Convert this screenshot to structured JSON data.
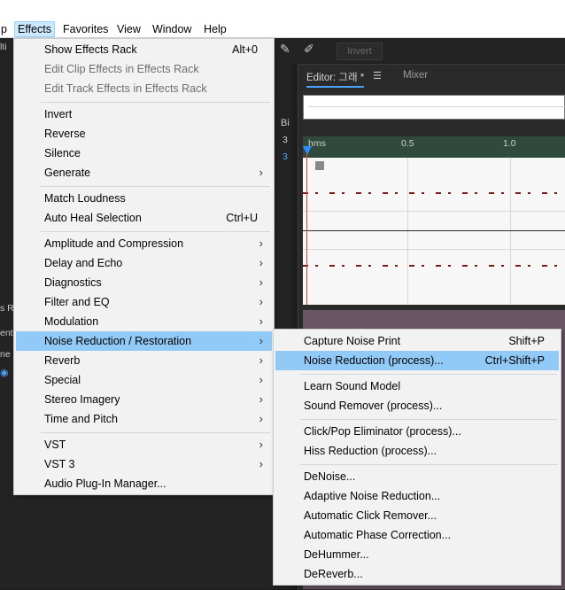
{
  "menubar": {
    "items": [
      {
        "label": "p",
        "active": false
      },
      {
        "label": "Effects",
        "active": true
      },
      {
        "label": "Favorites",
        "active": false
      },
      {
        "label": "View",
        "active": false
      },
      {
        "label": "Window",
        "active": false
      },
      {
        "label": "Help",
        "active": false
      }
    ]
  },
  "background": {
    "left_fragments": [
      "lti",
      "Bi",
      "3",
      "3",
      "s R",
      "ent",
      "ne"
    ],
    "toolbar": {
      "invert_label": "Invert"
    },
    "editor": {
      "tab_editor": "Editor: 그래 *",
      "tab_mixer": "Mixer",
      "ruler": [
        "hms",
        "0.5",
        "1.0"
      ]
    }
  },
  "effects_menu": {
    "items": [
      {
        "label": "Show Effects Rack",
        "shortcut": "Alt+0",
        "disabled": false,
        "submenu": false
      },
      {
        "label": "Edit Clip Effects in Effects Rack",
        "shortcut": "",
        "disabled": true,
        "submenu": false
      },
      {
        "label": "Edit Track Effects in Effects Rack",
        "shortcut": "",
        "disabled": true,
        "submenu": false
      },
      {
        "separator": true
      },
      {
        "label": "Invert",
        "shortcut": "",
        "disabled": false,
        "submenu": false
      },
      {
        "label": "Reverse",
        "shortcut": "",
        "disabled": false,
        "submenu": false
      },
      {
        "label": "Silence",
        "shortcut": "",
        "disabled": false,
        "submenu": false
      },
      {
        "label": "Generate",
        "shortcut": "",
        "disabled": false,
        "submenu": true
      },
      {
        "separator": true
      },
      {
        "label": "Match Loudness",
        "shortcut": "",
        "disabled": false,
        "submenu": false
      },
      {
        "label": "Auto Heal Selection",
        "shortcut": "Ctrl+U",
        "disabled": false,
        "submenu": false
      },
      {
        "separator": true
      },
      {
        "label": "Amplitude and Compression",
        "shortcut": "",
        "disabled": false,
        "submenu": true
      },
      {
        "label": "Delay and Echo",
        "shortcut": "",
        "disabled": false,
        "submenu": true
      },
      {
        "label": "Diagnostics",
        "shortcut": "",
        "disabled": false,
        "submenu": true
      },
      {
        "label": "Filter and EQ",
        "shortcut": "",
        "disabled": false,
        "submenu": true
      },
      {
        "label": "Modulation",
        "shortcut": "",
        "disabled": false,
        "submenu": true
      },
      {
        "label": "Noise Reduction / Restoration",
        "shortcut": "",
        "disabled": false,
        "submenu": true,
        "highlighted": true
      },
      {
        "label": "Reverb",
        "shortcut": "",
        "disabled": false,
        "submenu": true
      },
      {
        "label": "Special",
        "shortcut": "",
        "disabled": false,
        "submenu": true
      },
      {
        "label": "Stereo Imagery",
        "shortcut": "",
        "disabled": false,
        "submenu": true
      },
      {
        "label": "Time and Pitch",
        "shortcut": "",
        "disabled": false,
        "submenu": true
      },
      {
        "separator": true
      },
      {
        "label": "VST",
        "shortcut": "",
        "disabled": false,
        "submenu": true
      },
      {
        "label": "VST 3",
        "shortcut": "",
        "disabled": false,
        "submenu": true
      },
      {
        "label": "Audio Plug-In Manager...",
        "shortcut": "",
        "disabled": false,
        "submenu": false
      }
    ]
  },
  "noise_submenu": {
    "items": [
      {
        "label": "Capture Noise Print",
        "shortcut": "Shift+P"
      },
      {
        "label": "Noise Reduction (process)...",
        "shortcut": "Ctrl+Shift+P",
        "highlighted": true
      },
      {
        "separator": true
      },
      {
        "label": "Learn Sound Model",
        "shortcut": ""
      },
      {
        "label": "Sound Remover (process)...",
        "shortcut": ""
      },
      {
        "separator": true
      },
      {
        "label": "Click/Pop Eliminator (process)...",
        "shortcut": ""
      },
      {
        "label": "Hiss Reduction (process)...",
        "shortcut": ""
      },
      {
        "separator": true
      },
      {
        "label": "DeNoise...",
        "shortcut": ""
      },
      {
        "label": "Adaptive Noise Reduction...",
        "shortcut": ""
      },
      {
        "label": "Automatic Click Remover...",
        "shortcut": ""
      },
      {
        "label": "Automatic Phase Correction...",
        "shortcut": ""
      },
      {
        "label": "DeHummer...",
        "shortcut": ""
      },
      {
        "label": "DeReverb...",
        "shortcut": ""
      }
    ]
  },
  "colors": {
    "menu_highlight": "#91c9f7",
    "menubar_active": "#cce8ff",
    "ruler_green": "#2f4a3c",
    "playhead_blue": "#2f8cff"
  }
}
